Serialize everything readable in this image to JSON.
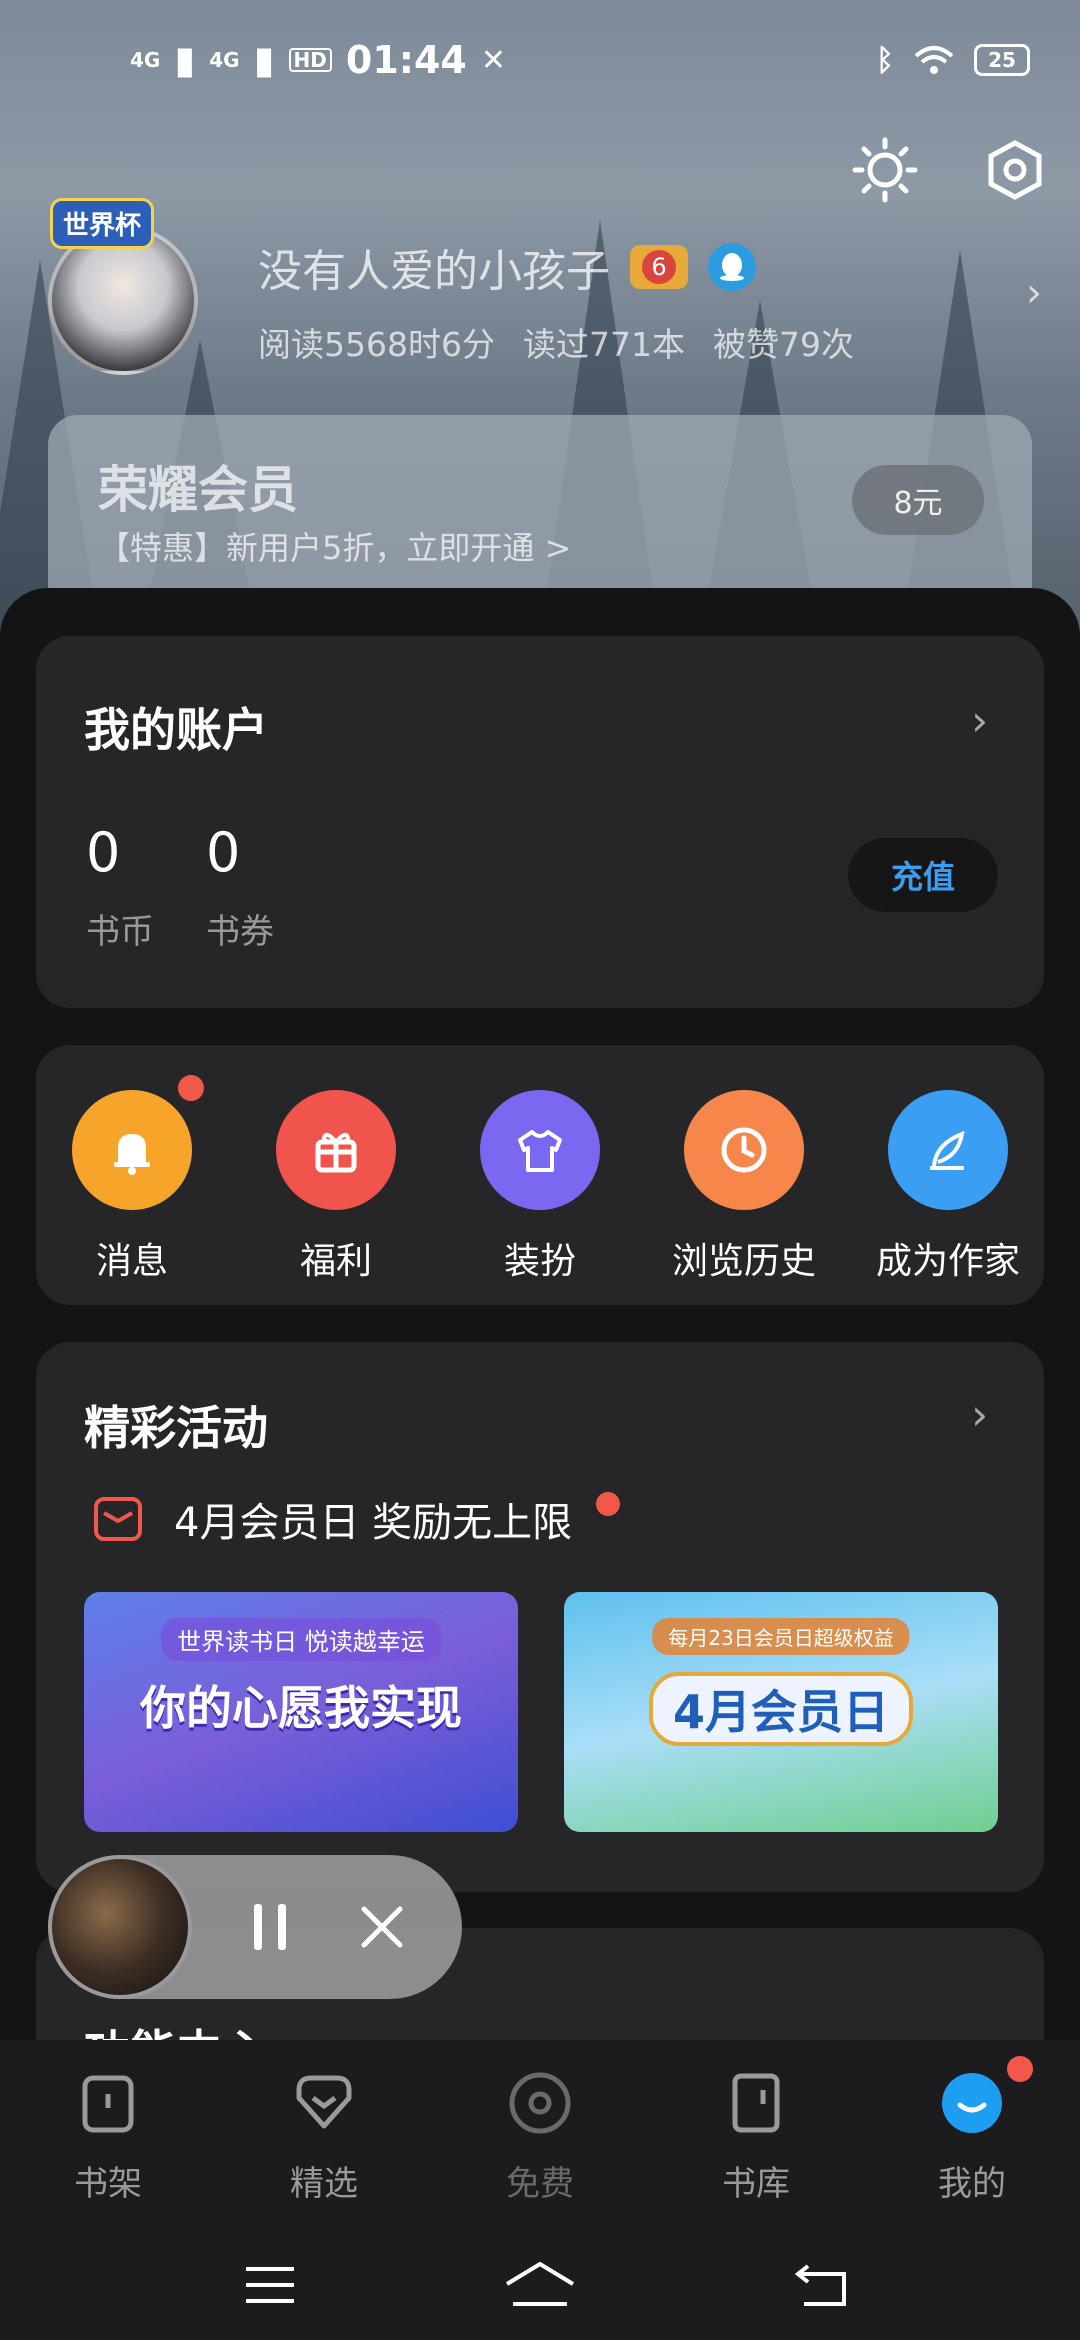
{
  "status": {
    "signal1": "4G",
    "signal2": "4G",
    "hd": "HD",
    "time": "01:44",
    "battery": "25"
  },
  "profile": {
    "avatar_badge": "世界杯",
    "username": "没有人爱的小孩子",
    "level": "6",
    "stats": [
      "阅读5568时6分",
      "读过771本",
      "被赞79次"
    ]
  },
  "vip": {
    "title": "荣耀会员",
    "subtitle": "【特惠】新用户5折，立即开通 >",
    "price": "8元"
  },
  "account": {
    "title": "我的账户",
    "coins_value": "0",
    "coins_label": "书币",
    "tickets_value": "0",
    "tickets_label": "书券",
    "recharge_label": "充值"
  },
  "quick": [
    {
      "label": "消息",
      "color": "#f7a52a",
      "icon": "bell-icon"
    },
    {
      "label": "福利",
      "color": "#f1544c",
      "icon": "gift-icon"
    },
    {
      "label": "装扮",
      "color": "#7a68f0",
      "icon": "shirt-icon"
    },
    {
      "label": "浏览历史",
      "color": "#f7864a",
      "icon": "clock-icon"
    },
    {
      "label": "成为作家",
      "color": "#3a9ef3",
      "icon": "feather-icon"
    }
  ],
  "activities": {
    "title": "精彩活动",
    "headline": "4月会员日 奖励无上限",
    "banner1_tag": "世界读书日 悦读越幸运",
    "banner1_main": "你的心愿我实现",
    "banner2_tag": "每月23日会员日超级权益",
    "banner2_main": "4月会员日"
  },
  "functions": {
    "title": "功能中心"
  },
  "tabs": [
    {
      "label": "书架",
      "icon": "bookshelf-icon"
    },
    {
      "label": "精选",
      "icon": "featured-icon"
    },
    {
      "label": "免费",
      "icon": "free-icon"
    },
    {
      "label": "书库",
      "icon": "library-icon"
    },
    {
      "label": "我的",
      "icon": "me-icon"
    }
  ],
  "colors": {
    "accent": "#3a9df0",
    "badge_red": "#f2574b",
    "card_bg": "#262628"
  }
}
